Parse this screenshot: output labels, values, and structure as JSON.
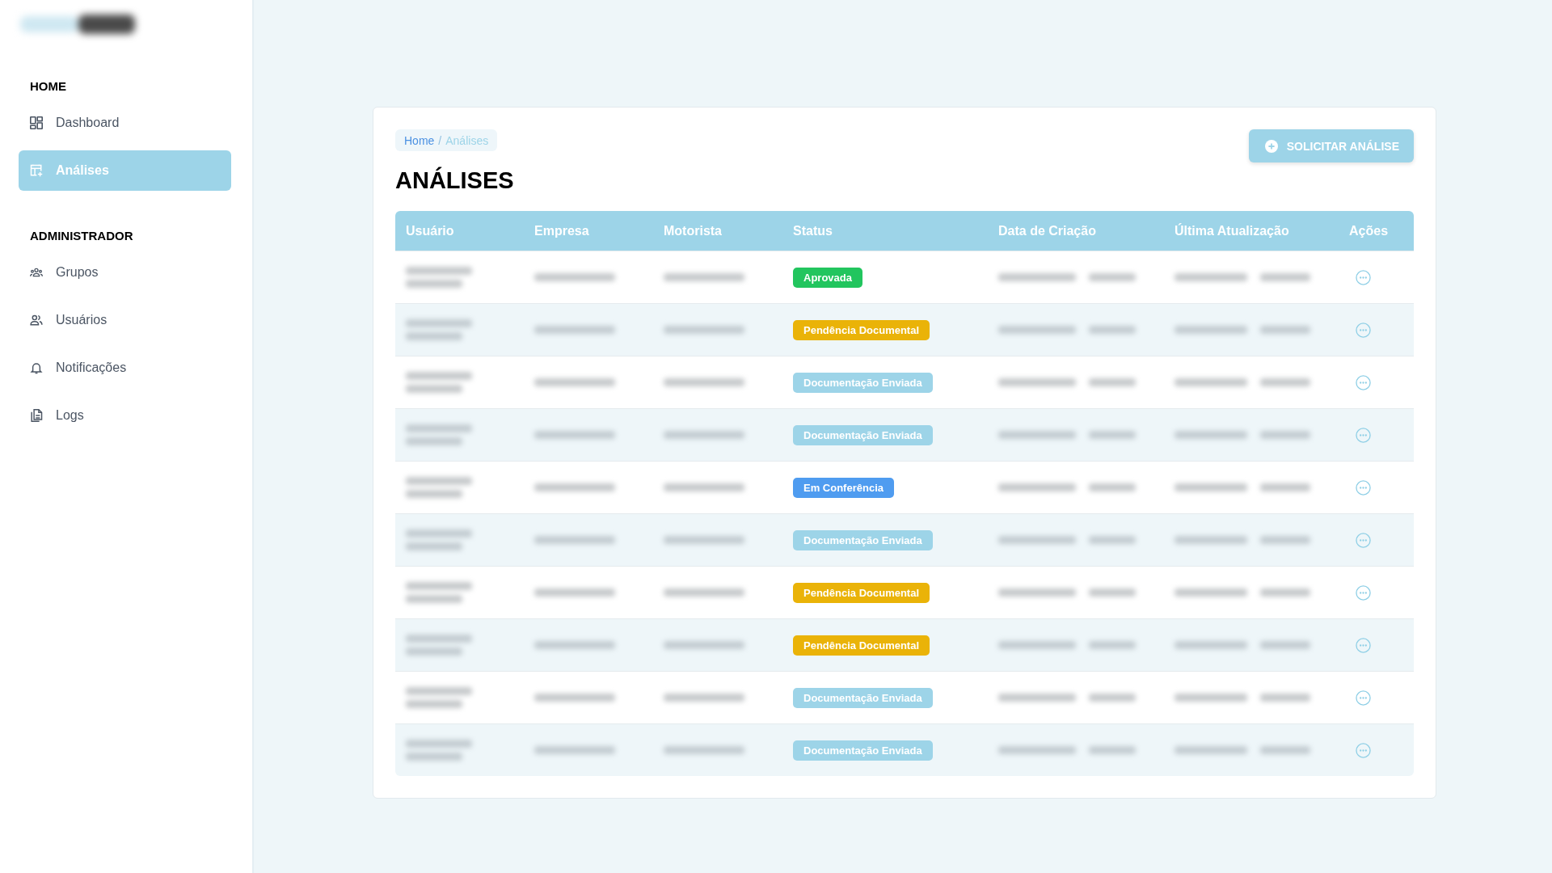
{
  "sidebar": {
    "sections": [
      {
        "title": "HOME",
        "items": [
          {
            "label": "Dashboard",
            "kind": "dashboard",
            "selected": false
          },
          {
            "label": "Análises",
            "kind": "analyses",
            "selected": true
          }
        ]
      },
      {
        "title": "ADMINISTRADOR",
        "items": [
          {
            "label": "Grupos",
            "kind": "groups",
            "selected": false
          },
          {
            "label": "Usuários",
            "kind": "users",
            "selected": false
          },
          {
            "label": "Notificações",
            "kind": "notifications",
            "selected": false
          },
          {
            "label": "Logs",
            "kind": "logs",
            "selected": false
          }
        ]
      }
    ]
  },
  "breadcrumb": {
    "separator": "/",
    "items": [
      {
        "label": "Home",
        "current": false
      },
      {
        "label": "Análises",
        "current": true
      }
    ]
  },
  "page_title": "ANÁLISES",
  "primary_button": {
    "label": "SOLICITAR ANÁLISE"
  },
  "table": {
    "columns": [
      "Usuário",
      "Empresa",
      "Motorista",
      "Status",
      "Data de Criação",
      "Última Atualização",
      "Ações"
    ],
    "rows": [
      {
        "status": {
          "label": "Aprovada",
          "color": "#22c55e"
        }
      },
      {
        "status": {
          "label": "Pendência Documental",
          "color": "#eab308"
        }
      },
      {
        "status": {
          "label": "Documentação Enviada",
          "color": "#9dd4e8"
        }
      },
      {
        "status": {
          "label": "Documentação Enviada",
          "color": "#9dd4e8"
        }
      },
      {
        "status": {
          "label": "Em Conferência",
          "color": "#4f9cf0"
        }
      },
      {
        "status": {
          "label": "Documentação Enviada",
          "color": "#9dd4e8"
        }
      },
      {
        "status": {
          "label": "Pendência Documental",
          "color": "#eab308"
        }
      },
      {
        "status": {
          "label": "Pendência Documental",
          "color": "#eab308"
        }
      },
      {
        "status": {
          "label": "Documentação Enviada",
          "color": "#9dd4e8"
        }
      },
      {
        "status": {
          "label": "Documentação Enviada",
          "color": "#9dd4e8"
        }
      }
    ]
  }
}
